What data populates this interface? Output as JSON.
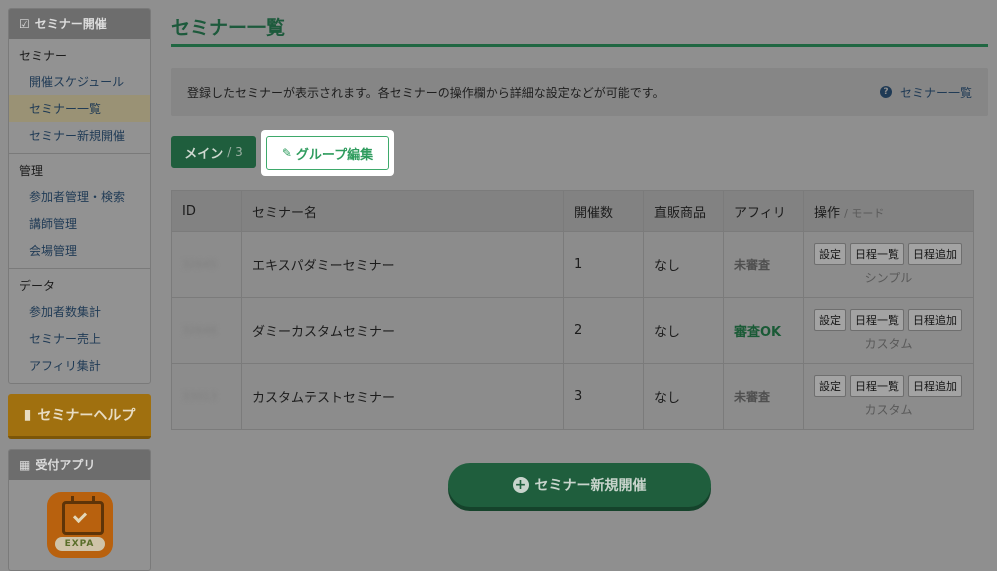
{
  "sidebar": {
    "header_title": "セミナー開催",
    "groups": [
      {
        "title": "セミナー",
        "items": [
          {
            "label": "開催スケジュール"
          },
          {
            "label": "セミナー一覧"
          },
          {
            "label": "セミナー新規開催"
          }
        ]
      },
      {
        "title": "管理",
        "items": [
          {
            "label": "参加者管理・検索"
          },
          {
            "label": "講師管理"
          },
          {
            "label": "会場管理"
          }
        ]
      },
      {
        "title": "データ",
        "items": [
          {
            "label": "参加者数集計"
          },
          {
            "label": "セミナー売上"
          },
          {
            "label": "アフィリ集計"
          }
        ]
      }
    ],
    "help_button": "セミナーヘルプ",
    "app_panel_title": "受付アプリ",
    "app_icon_text": "EXPA"
  },
  "main": {
    "title": "セミナー一覧",
    "notice_text": "登録したセミナーが表示されます。各セミナーの操作欄から詳細な設定などが可能です。",
    "notice_link": "セミナー一覧",
    "tab_main_label": "メイン",
    "tab_main_count": "/ 3",
    "group_edit_label": "グループ編集",
    "table": {
      "headers": {
        "id": "ID",
        "name": "セミナー名",
        "count": "開催数",
        "product": "直販商品",
        "affiliate": "アフィリ",
        "ops": "操作",
        "ops_sub": "/ モード"
      },
      "rows": [
        {
          "id": "32645",
          "name": "エキスパダミーセミナー",
          "count": "1",
          "product": "なし",
          "affiliate": "未審査",
          "mode": "シンプル"
        },
        {
          "id": "32646",
          "name": "ダミーカスタムセミナー",
          "count": "2",
          "product": "なし",
          "affiliate": "審査OK",
          "mode": "カスタム"
        },
        {
          "id": "33013",
          "name": "カスタムテストセミナー",
          "count": "3",
          "product": "なし",
          "affiliate": "未審査",
          "mode": "カスタム"
        }
      ],
      "op_buttons": {
        "settings": "設定",
        "schedule_list": "日程一覧",
        "schedule_add": "日程追加"
      }
    },
    "new_button": "セミナー新規開催"
  },
  "colors": {
    "accent_green": "#2f9c5e",
    "help_orange": "#f0a000",
    "overlay": "#8f8f8f"
  }
}
